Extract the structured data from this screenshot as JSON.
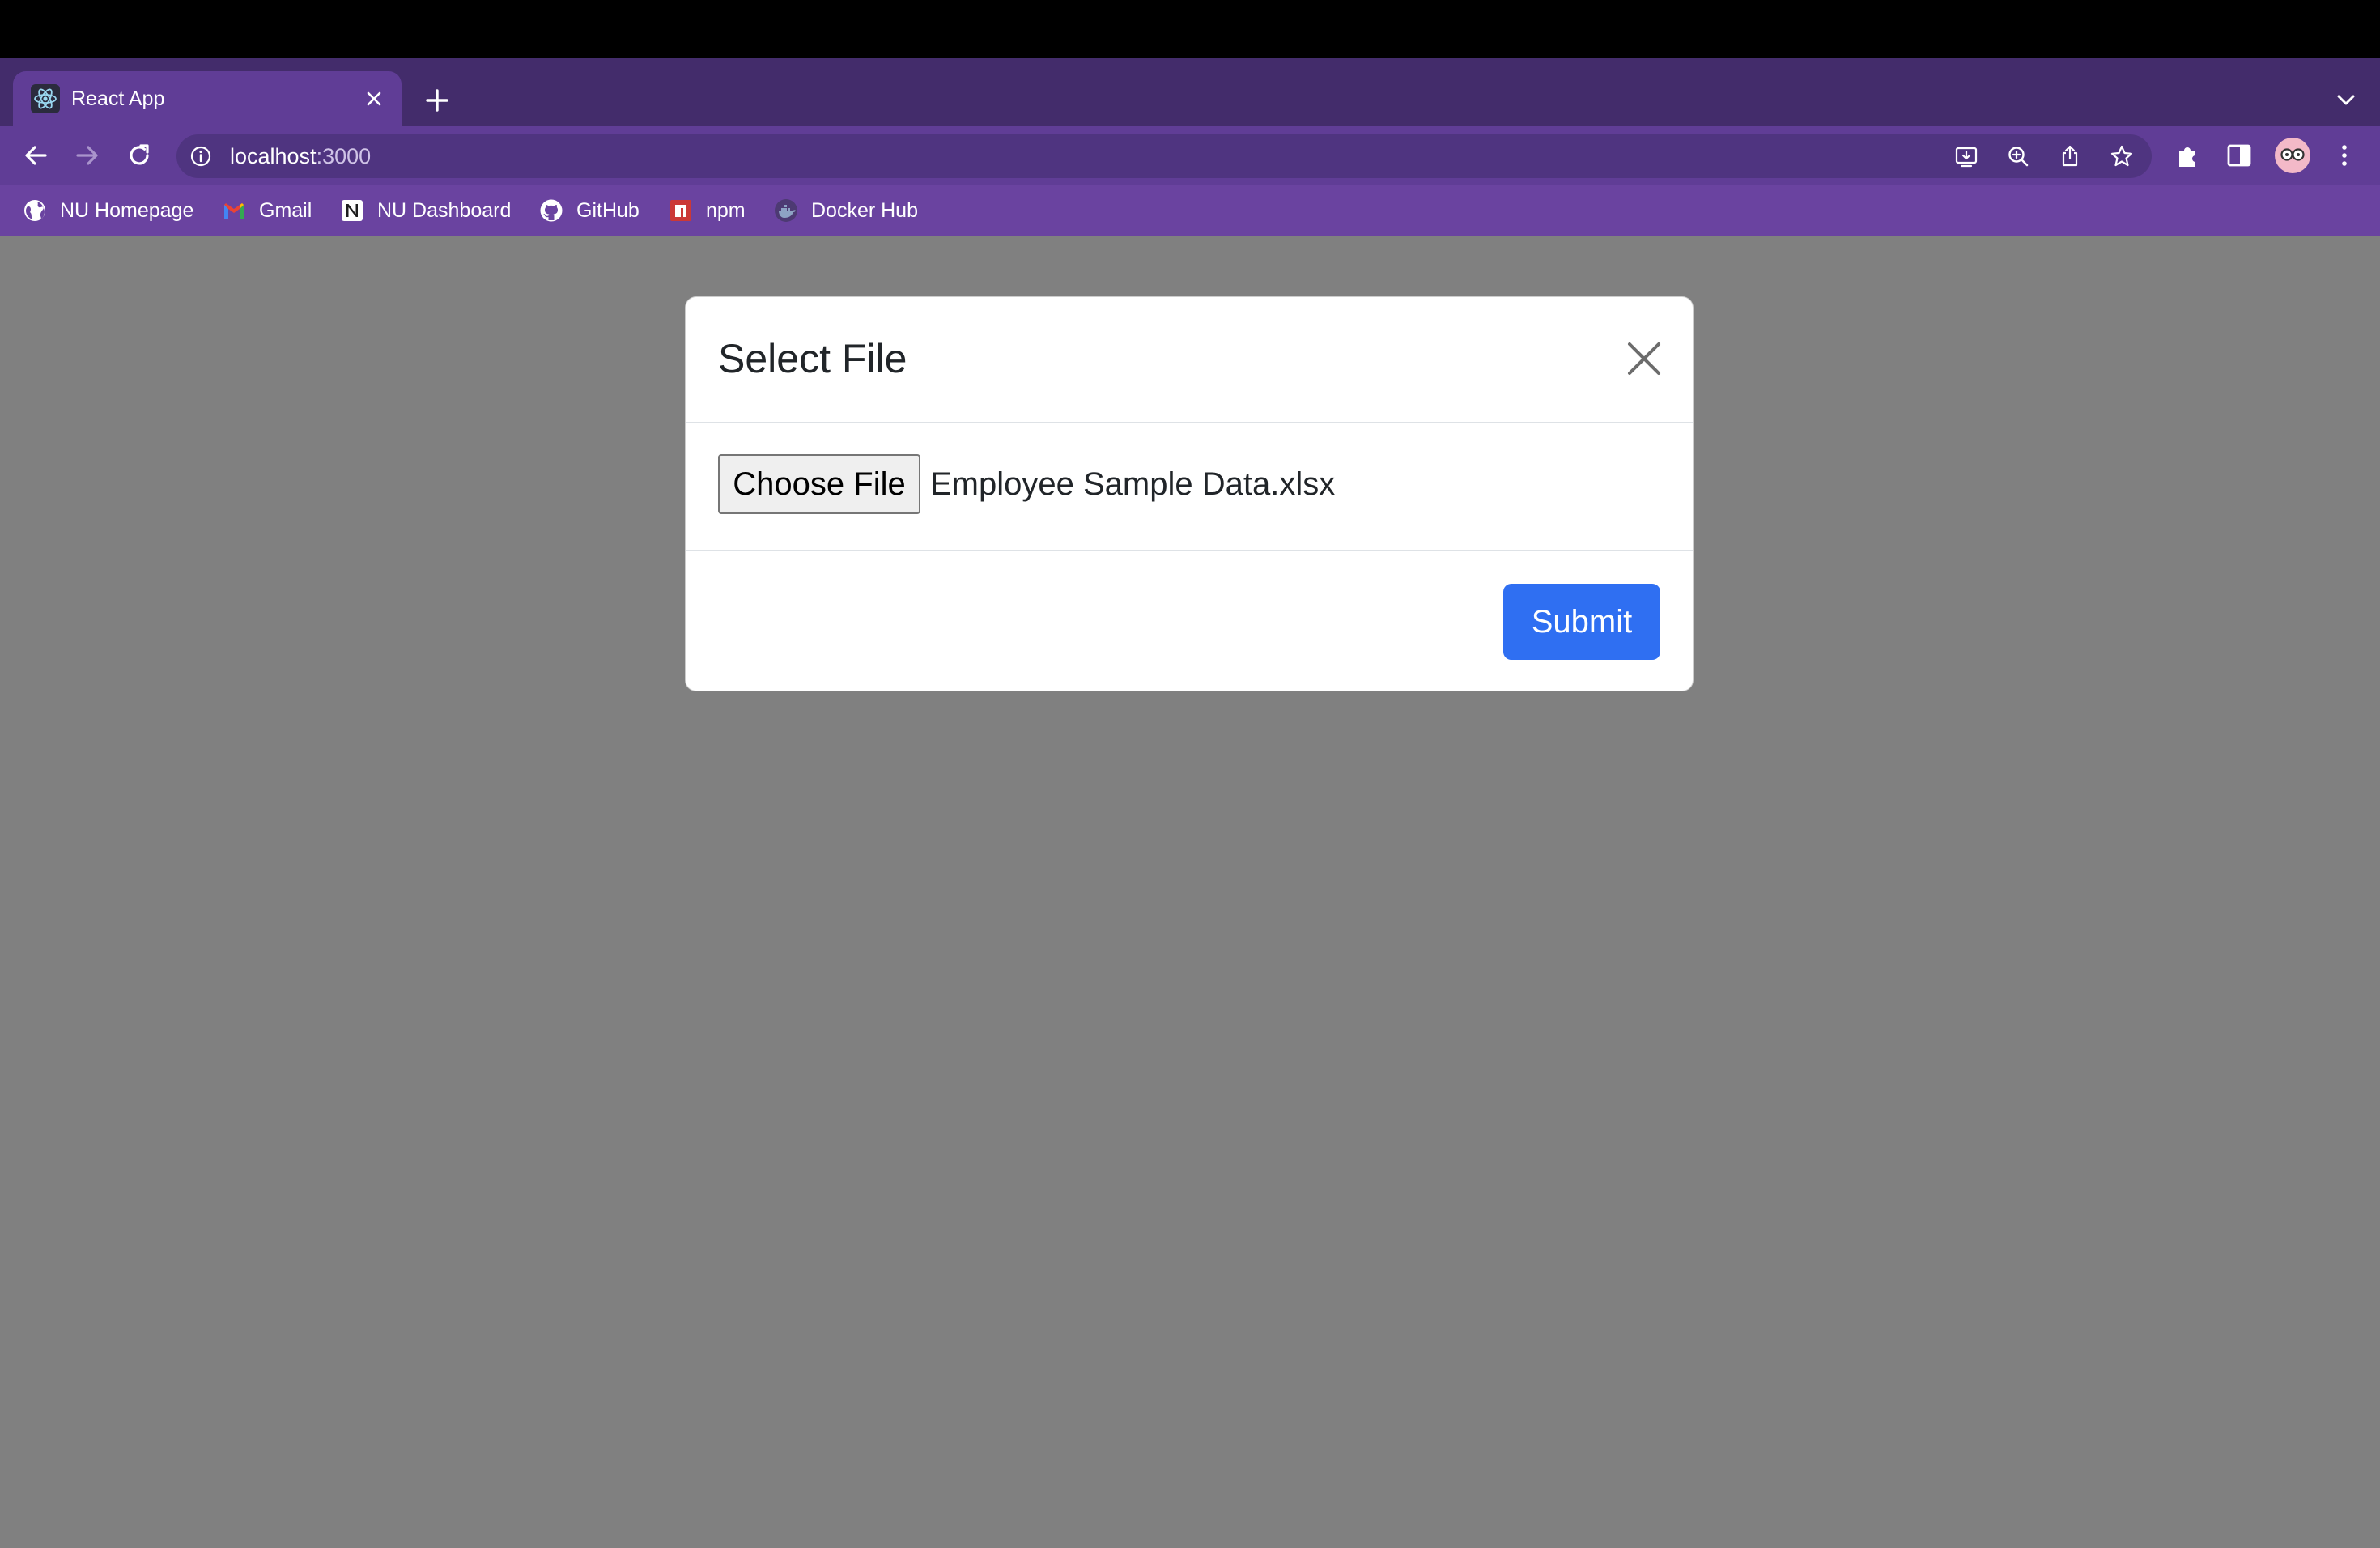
{
  "browser": {
    "tab": {
      "title": "React App",
      "favicon": "react-icon"
    },
    "address": {
      "host": "localhost",
      "port": ":3000"
    },
    "bookmarks": [
      {
        "label": "NU Homepage",
        "icon": "globe-icon"
      },
      {
        "label": "Gmail",
        "icon": "gmail-icon"
      },
      {
        "label": "NU Dashboard",
        "icon": "notion-icon"
      },
      {
        "label": "GitHub",
        "icon": "github-icon"
      },
      {
        "label": "npm",
        "icon": "npm-icon"
      },
      {
        "label": "Docker Hub",
        "icon": "docker-icon"
      }
    ],
    "colors": {
      "tabstrip": "#432c6b",
      "toolbar": "#603d96",
      "bookmarks_bar": "#6a43a0"
    }
  },
  "modal": {
    "title": "Select File",
    "file_button": "Choose File",
    "file_name": "Employee Sample Data.xlsx",
    "submit": "Submit",
    "colors": {
      "submit": "#2f6ff2",
      "overlay": "#808080"
    }
  }
}
